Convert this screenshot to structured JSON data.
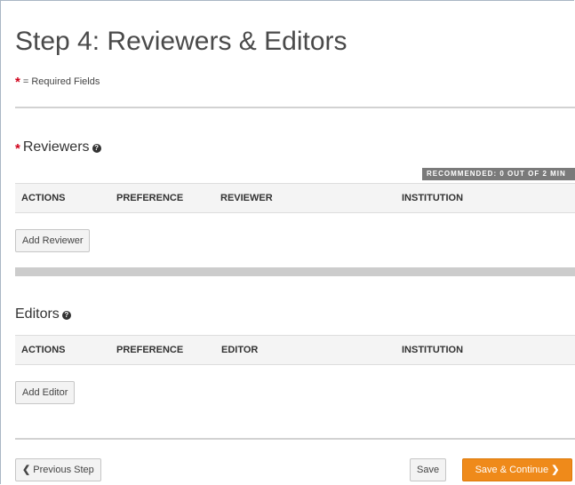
{
  "page": {
    "title": "Step 4: Reviewers & Editors",
    "required_asterisk": "*",
    "required_note": "= Required Fields"
  },
  "reviewers": {
    "required_asterisk": "*",
    "title": "Reviewers",
    "help_icon": "question-circle-icon",
    "recommended_badge": "RECOMMENDED: 0 OUT OF 2 MIN",
    "columns": [
      "ACTIONS",
      "PREFERENCE",
      "REVIEWER",
      "INSTITUTION"
    ],
    "rows": [],
    "add_button": "Add Reviewer"
  },
  "editors": {
    "title": "Editors",
    "help_icon": "question-circle-icon",
    "columns": [
      "ACTIONS",
      "PREFERENCE",
      "EDITOR",
      "INSTITUTION"
    ],
    "rows": [],
    "add_button": "Add Editor"
  },
  "footer": {
    "previous_icon": "chevron-left-icon",
    "previous_label": "Previous Step",
    "save_label": "Save",
    "save_continue_label": "Save & Continue",
    "save_continue_icon": "chevron-right-icon"
  },
  "colors": {
    "primary_button": "#ef8a1a",
    "required_asterisk": "#d0021b",
    "badge_background": "#7a7a7a"
  }
}
